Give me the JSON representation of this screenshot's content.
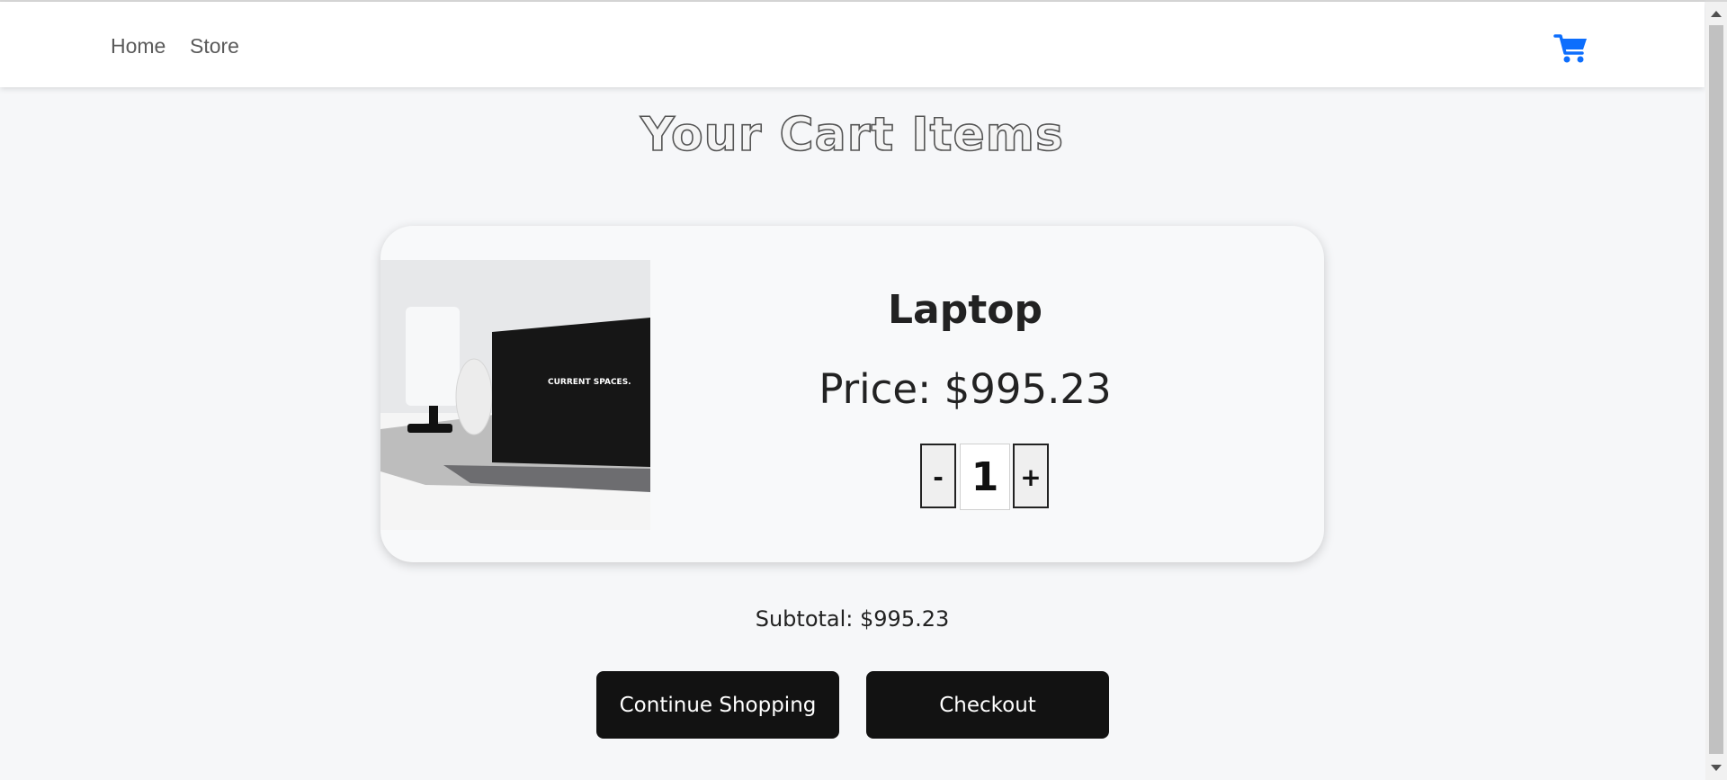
{
  "nav": {
    "home_label": "Home",
    "store_label": "Store",
    "cart_icon": "shopping-cart-icon",
    "cart_icon_color": "#0d6efd"
  },
  "page": {
    "title": "Your Cart Items"
  },
  "cart": {
    "items": [
      {
        "name": "Laptop",
        "price_text": "Price: $995.23",
        "quantity": "1",
        "image_text": "CURRENT SPACES.",
        "minus_label": "-",
        "plus_label": "+"
      }
    ],
    "subtotal_text": "Subtotal: $995.23"
  },
  "actions": {
    "continue_label": "Continue Shopping",
    "checkout_label": "Checkout"
  },
  "colors": {
    "background": "#f6f7f9",
    "button_bg": "#121212",
    "accent": "#0d6efd"
  }
}
